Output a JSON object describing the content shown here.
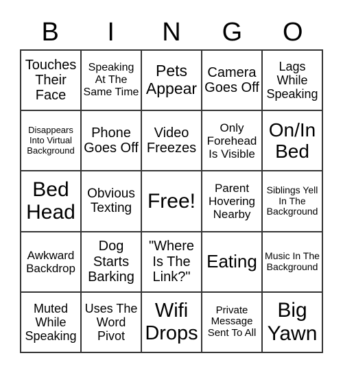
{
  "header": {
    "letters": [
      "B",
      "I",
      "N",
      "G",
      "O"
    ]
  },
  "cells": [
    "Touches Their Face",
    "Speaking At The Same Time",
    "Pets Appear",
    "Camera Goes Off",
    "Lags While Speaking",
    "Disappears Into Virtual Background",
    "Phone Goes Off",
    "Video Freezes",
    "Only Forehead Is Visible",
    "On/In Bed",
    "Bed Head",
    "Obvious Texting",
    "Free!",
    "Parent Hovering Nearby",
    "Siblings Yell In The Background",
    "Awkward Backdrop",
    "Dog Starts Barking",
    "\"Where Is The Link?\"",
    "Eating",
    "Music In The Background",
    "Muted While Speaking",
    "Uses The Word Pivot",
    "Wifi Drops",
    "Private Message Sent To All",
    "Big Yawn"
  ]
}
